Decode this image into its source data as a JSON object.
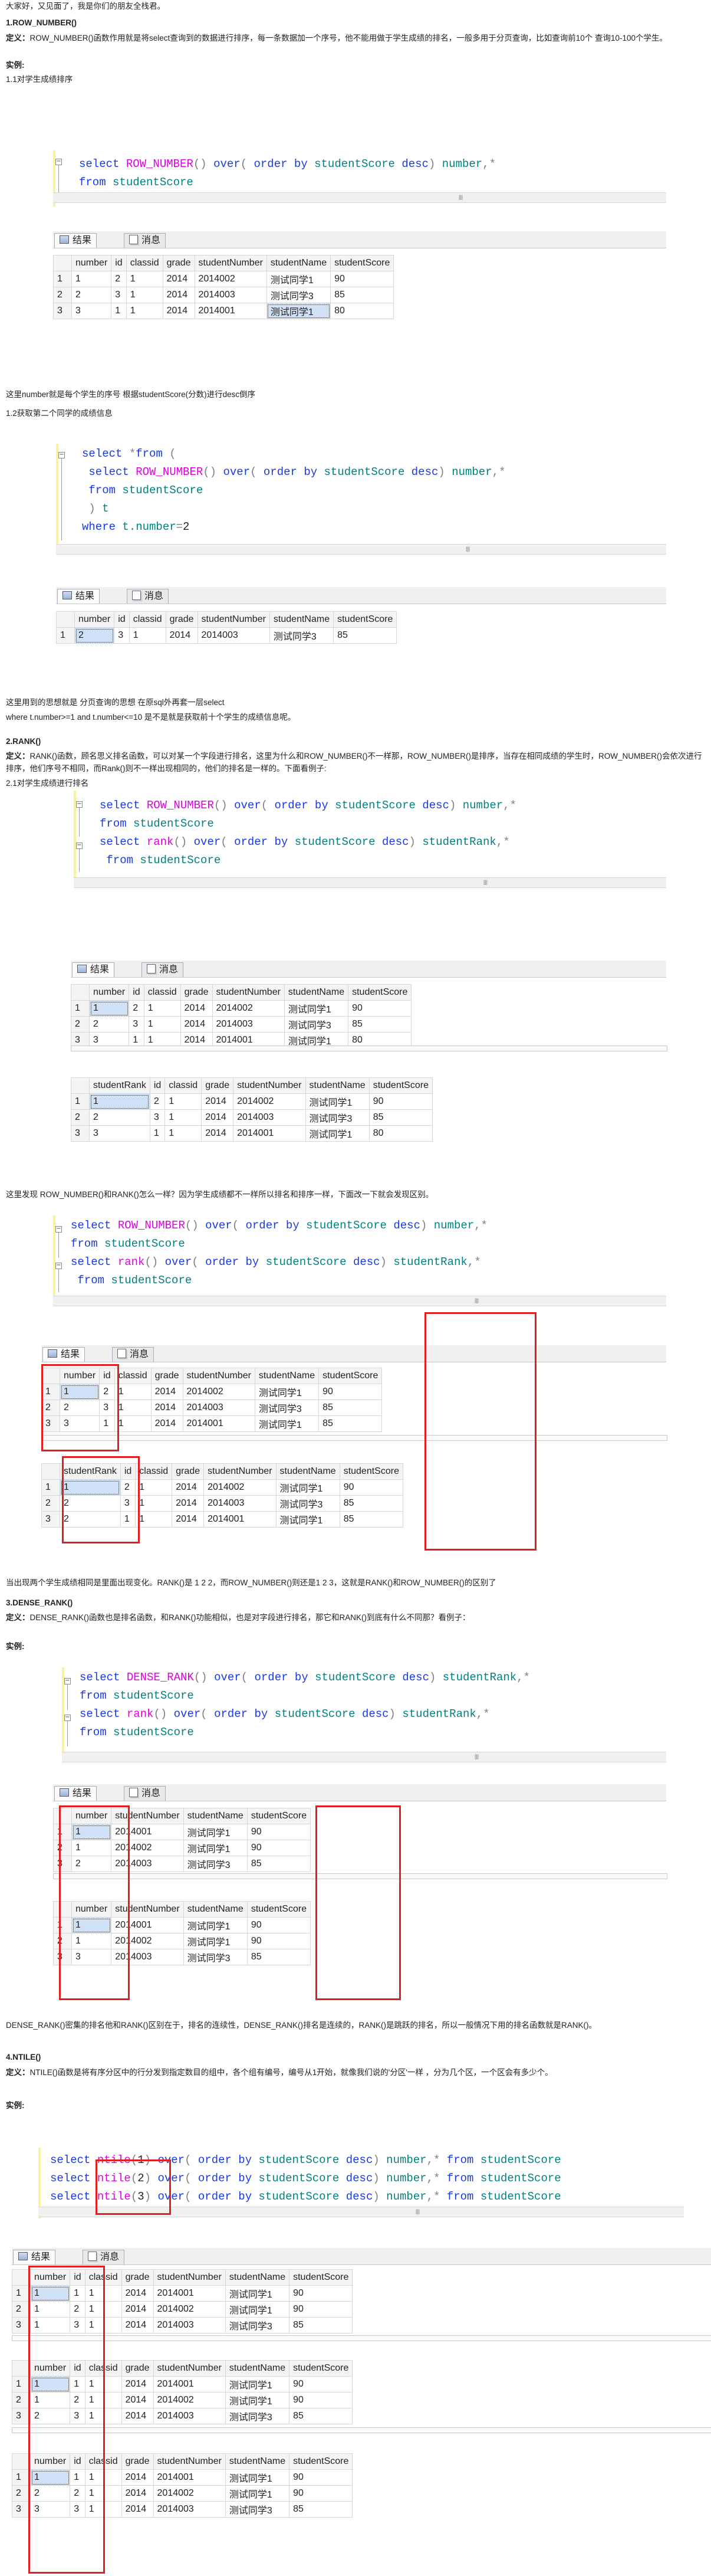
{
  "intro": "大家好，又见面了，我是你们的朋友全栈君。",
  "s1": {
    "title": "1.ROW_NUMBER()",
    "def_label": "定义：",
    "def": "ROW_NUMBER()函数作用就是将select查询到的数据进行排序，每一条数据加一个序号，他不能用做于学生成绩的排名，一般多用于分页查询，比如查询前10个 查询10-100个学生。",
    "example": "实例:",
    "ex1": "1.1对学生成绩排序",
    "ex1_note": "这里number就是每个学生的序号 根据studentScore(分数)进行desc倒序",
    "ex2": "1.2获取第二个同学的成绩信息",
    "ex2_note1": "这里用到的思想就是 分页查询的思想 在原sql外再套一层select",
    "ex2_note2": "where t.number>=1 and t.number<=10 是不是就是获取前十个学生的成绩信息呢。"
  },
  "s2": {
    "title": "2.RANK()",
    "def_label": "定义：",
    "def": "RANK()函数，顾名思义排名函数，可以对某一个字段进行排名，这里为什么和ROW_NUMBER()不一样那，ROW_NUMBER()是排序，当存在相同成绩的学生时，ROW_NUMBER()会依次进行排序，他们序号不相同，而Rank()则不一样出现相同的，他们的排名是一样的。下面看例子:",
    "ex": "2.1对学生成绩进行排名",
    "note1": "这里发现 ROW_NUMBER()和RANK()怎么一样？因为学生成绩都不一样所以排名和排序一样，下面改一下就会发现区别。",
    "note2": "当出现两个学生成绩相同是里面出现变化。RANK()是 1 2 2，而ROW_NUMBER()则还是1 2 3，这就是RANK()和ROW_NUMBER()的区别了"
  },
  "s3": {
    "title": "3.DENSE_RANK()",
    "def_label": "定义：",
    "def": "DENSE_RANK()函数也是排名函数，和RANK()功能相似，也是对字段进行排名，那它和RANK()到底有什么不同那？看例子：",
    "example": "实例:",
    "note": "DENSE_RANK()密集的排名他和RANK()区别在于，排名的连续性，DENSE_RANK()排名是连续的，RANK()是跳跃的排名，所以一般情况下用的排名函数就是RANK()。"
  },
  "s4": {
    "title": "4.NTILE()",
    "def_label": "定义：",
    "def": "NTILE()函数是将有序分区中的行分发到指定数目的组中，各个组有编号，编号从1开始，就像我们说的'分区'一样 ，分为几个区，一个区会有多少个。",
    "example": "实例:"
  },
  "tabs": {
    "results": "结果",
    "messages": "消息"
  },
  "cols": {
    "number": "number",
    "id": "id",
    "classid": "classid",
    "grade": "grade",
    "studentNumber": "studentNumber",
    "studentName": "studentName",
    "studentScore": "studentScore",
    "studentRank": "studentRank"
  },
  "rownums": [
    "1",
    "2",
    "3"
  ],
  "grid_a": [
    [
      "1",
      "1",
      "2",
      "1",
      "2014",
      "2014002",
      "测试同学1",
      "90"
    ],
    [
      "2",
      "2",
      "3",
      "1",
      "2014",
      "2014003",
      "测试同学3",
      "85"
    ],
    [
      "3",
      "3",
      "1",
      "1",
      "2014",
      "2014001",
      "测试同学1",
      "80"
    ]
  ],
  "grid_b": [
    [
      "2",
      "3",
      "1",
      "2014",
      "2014003",
      "测试同学3",
      "85"
    ]
  ],
  "grid_b_rownum": "1",
  "grid_c2": [
    [
      "1",
      "1",
      "2",
      "1",
      "2014",
      "2014002",
      "测试同学1",
      "90"
    ],
    [
      "2",
      "2",
      "3",
      "1",
      "2014",
      "2014003",
      "测试同学3",
      "85"
    ],
    [
      "3",
      "3",
      "1",
      "1",
      "2014",
      "2014001",
      "测试同学1",
      "80"
    ]
  ],
  "grid_d1": [
    [
      "1",
      "1",
      "2",
      "1",
      "2014",
      "2014002",
      "测试同学1",
      "90"
    ],
    [
      "2",
      "2",
      "3",
      "1",
      "2014",
      "2014003",
      "测试同学3",
      "85"
    ],
    [
      "3",
      "3",
      "1",
      "1",
      "2014",
      "2014001",
      "测试同学1",
      "85"
    ]
  ],
  "grid_d2": [
    [
      "1",
      "1",
      "2",
      "1",
      "2014",
      "2014002",
      "测试同学1",
      "90"
    ],
    [
      "2",
      "2",
      "3",
      "1",
      "2014",
      "2014003",
      "测试同学3",
      "85"
    ],
    [
      "3",
      "2",
      "1",
      "1",
      "2014",
      "2014001",
      "测试同学1",
      "85"
    ]
  ],
  "grid_e1": [
    [
      "1",
      "1",
      "2014001",
      "测试同学1",
      "90"
    ],
    [
      "2",
      "1",
      "2014002",
      "测试同学1",
      "90"
    ],
    [
      "3",
      "2",
      "2014003",
      "测试同学3",
      "85"
    ]
  ],
  "grid_e2": [
    [
      "1",
      "1",
      "2014001",
      "测试同学1",
      "90"
    ],
    [
      "2",
      "1",
      "2014002",
      "测试同学1",
      "90"
    ],
    [
      "3",
      "3",
      "2014003",
      "测试同学3",
      "85"
    ]
  ],
  "grid_f1": [
    [
      "1",
      "1",
      "1",
      "1",
      "2014",
      "2014001",
      "测试同学1",
      "90"
    ],
    [
      "2",
      "1",
      "2",
      "1",
      "2014",
      "2014002",
      "测试同学1",
      "90"
    ],
    [
      "3",
      "1",
      "3",
      "1",
      "2014",
      "2014003",
      "测试同学3",
      "85"
    ]
  ],
  "grid_f2": [
    [
      "1",
      "1",
      "1",
      "1",
      "2014",
      "2014001",
      "测试同学1",
      "90"
    ],
    [
      "2",
      "1",
      "2",
      "1",
      "2014",
      "2014002",
      "测试同学1",
      "90"
    ],
    [
      "3",
      "2",
      "3",
      "1",
      "2014",
      "2014003",
      "测试同学3",
      "85"
    ]
  ],
  "grid_f3": [
    [
      "1",
      "1",
      "1",
      "1",
      "2014",
      "2014001",
      "测试同学1",
      "90"
    ],
    [
      "2",
      "2",
      "2",
      "1",
      "2014",
      "2014002",
      "测试同学1",
      "90"
    ],
    [
      "3",
      "3",
      "3",
      "1",
      "2014",
      "2014003",
      "测试同学3",
      "85"
    ]
  ],
  "code": {
    "sel": "select",
    "rownum": "ROW_NUMBER",
    "rank": "rank",
    "dense": "DENSE_RANK",
    "ntile": "ntile",
    "over": "over",
    "order_by": "order by",
    "score": "studentScore",
    "desc": "desc",
    "number": "number",
    "rank_alias": "studentRank",
    "from": "from",
    "table": "studentScore",
    "star": "*",
    "where": "where",
    "t_number": "t.number",
    "t": "t",
    "two": "2",
    "n1": "1",
    "n2": "2",
    "n3": "3"
  },
  "colors": {
    "keyword": "#1a39e6",
    "function": "#e000e0",
    "identifier": "#008080",
    "highlight": "#e02020"
  }
}
